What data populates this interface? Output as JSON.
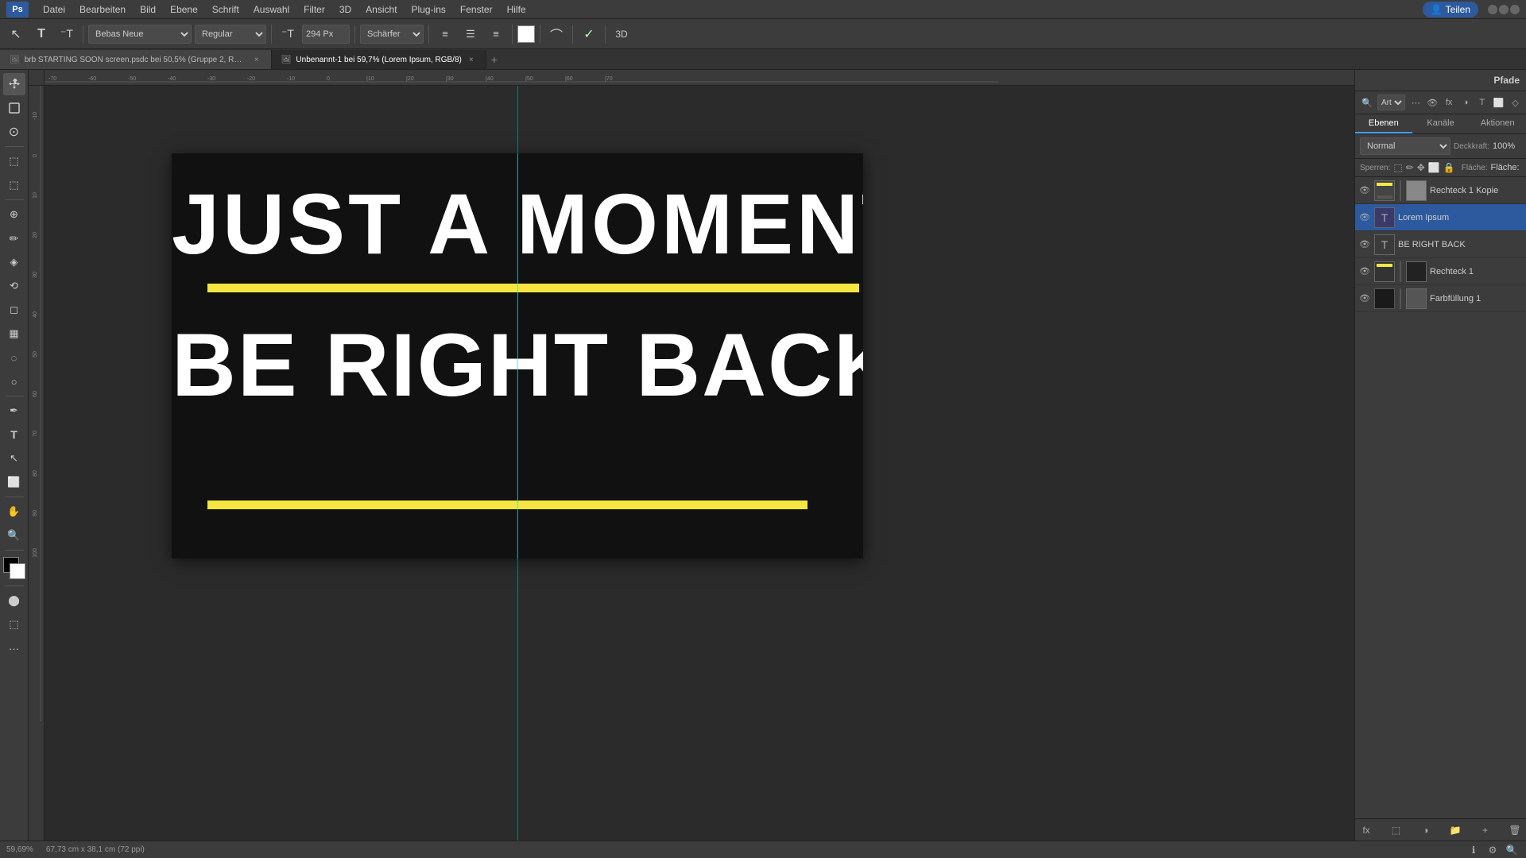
{
  "app": {
    "title": "Adobe Photoshop"
  },
  "menu": {
    "items": [
      "Datei",
      "Bearbeiten",
      "Bild",
      "Ebene",
      "Schrift",
      "Auswahl",
      "Filter",
      "3D",
      "Ansicht",
      "Plug-ins",
      "Fenster",
      "Hilfe"
    ]
  },
  "toolbar": {
    "font_family": "Bebas Neue",
    "font_style": "Regular",
    "font_size": "294 Px",
    "sharpness": "Schärfer",
    "align_icons": [
      "align-left",
      "align-center",
      "align-right"
    ],
    "color_swatch": "white",
    "warp_icon": true,
    "check_icon": true,
    "3d_icon": true
  },
  "tabs": [
    {
      "id": "tab1",
      "label": "brb STARTING SOON screen.psdc bei 50,5% (Gruppe 2, RGB/8)",
      "active": false
    },
    {
      "id": "tab2",
      "label": "Unbenannt-1 bei 59,7% (Lorem Ipsum, RGB/8)",
      "active": true
    }
  ],
  "canvas": {
    "text_top": "JUST A MOMENT",
    "text_bottom": "BE RIGHT BACK",
    "yellow_line_top": true,
    "yellow_line_bottom": true
  },
  "right_panel": {
    "title": "Pfade",
    "tabs": [
      "Ebenen",
      "Kanäle",
      "Aktionen"
    ],
    "active_tab": "Ebenen",
    "blend_mode": "Normal",
    "opacity_label": "Deckkraft:",
    "opacity_value": "100%",
    "fill_label": "Fläche:",
    "fill_value": "",
    "layers": [
      {
        "id": "layer1",
        "name": "Rechteck 1 Kopie",
        "type": "rect",
        "visible": true,
        "selected": false,
        "has_lock": false,
        "thumb_color": "#555"
      },
      {
        "id": "layer2",
        "name": "Lorem Ipsum",
        "type": "text",
        "visible": true,
        "selected": true,
        "has_lock": false,
        "thumb_color": "#4a4a4a"
      },
      {
        "id": "layer3",
        "name": "BE RIGHT BACK",
        "type": "text",
        "visible": true,
        "selected": false,
        "has_lock": false,
        "thumb_color": "#4a4a4a"
      },
      {
        "id": "layer4",
        "name": "Rechteck 1",
        "type": "rect_combined",
        "visible": true,
        "selected": false,
        "has_lock": false,
        "thumb_color": "#555"
      },
      {
        "id": "layer5",
        "name": "Farbfüllung 1",
        "type": "fill",
        "visible": true,
        "selected": false,
        "has_lock": false,
        "thumb_color": "#1a1a1a"
      }
    ]
  },
  "status_bar": {
    "zoom": "59,69%",
    "dimensions": "67,73 cm x 38,1 cm (72 ppi)"
  },
  "icons": {
    "eye": "👁",
    "text_t": "T",
    "move": "✥",
    "lasso": "⊙",
    "crop": "⬚",
    "brush": "✏",
    "eraser": "◻",
    "shape": "⬜",
    "pen": "✒",
    "type": "T",
    "zoom_glass": "🔍",
    "hand": "✋",
    "lock": "🔒",
    "chain": "🔗"
  }
}
